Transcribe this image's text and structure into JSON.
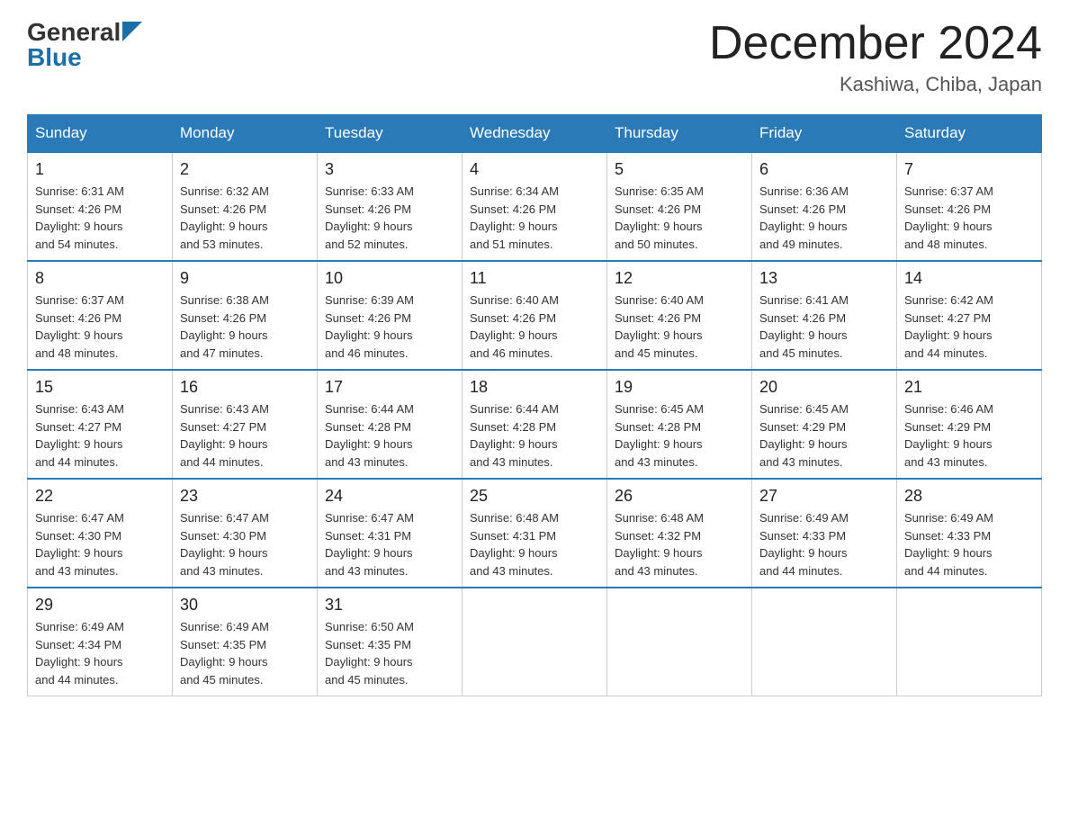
{
  "logo": {
    "general": "General",
    "arrow": "",
    "blue": "Blue"
  },
  "title": "December 2024",
  "subtitle": "Kashiwa, Chiba, Japan",
  "days_of_week": [
    "Sunday",
    "Monday",
    "Tuesday",
    "Wednesday",
    "Thursday",
    "Friday",
    "Saturday"
  ],
  "weeks": [
    [
      {
        "day": "1",
        "sunrise": "6:31 AM",
        "sunset": "4:26 PM",
        "daylight": "9 hours and 54 minutes."
      },
      {
        "day": "2",
        "sunrise": "6:32 AM",
        "sunset": "4:26 PM",
        "daylight": "9 hours and 53 minutes."
      },
      {
        "day": "3",
        "sunrise": "6:33 AM",
        "sunset": "4:26 PM",
        "daylight": "9 hours and 52 minutes."
      },
      {
        "day": "4",
        "sunrise": "6:34 AM",
        "sunset": "4:26 PM",
        "daylight": "9 hours and 51 minutes."
      },
      {
        "day": "5",
        "sunrise": "6:35 AM",
        "sunset": "4:26 PM",
        "daylight": "9 hours and 50 minutes."
      },
      {
        "day": "6",
        "sunrise": "6:36 AM",
        "sunset": "4:26 PM",
        "daylight": "9 hours and 49 minutes."
      },
      {
        "day": "7",
        "sunrise": "6:37 AM",
        "sunset": "4:26 PM",
        "daylight": "9 hours and 48 minutes."
      }
    ],
    [
      {
        "day": "8",
        "sunrise": "6:37 AM",
        "sunset": "4:26 PM",
        "daylight": "9 hours and 48 minutes."
      },
      {
        "day": "9",
        "sunrise": "6:38 AM",
        "sunset": "4:26 PM",
        "daylight": "9 hours and 47 minutes."
      },
      {
        "day": "10",
        "sunrise": "6:39 AM",
        "sunset": "4:26 PM",
        "daylight": "9 hours and 46 minutes."
      },
      {
        "day": "11",
        "sunrise": "6:40 AM",
        "sunset": "4:26 PM",
        "daylight": "9 hours and 46 minutes."
      },
      {
        "day": "12",
        "sunrise": "6:40 AM",
        "sunset": "4:26 PM",
        "daylight": "9 hours and 45 minutes."
      },
      {
        "day": "13",
        "sunrise": "6:41 AM",
        "sunset": "4:26 PM",
        "daylight": "9 hours and 45 minutes."
      },
      {
        "day": "14",
        "sunrise": "6:42 AM",
        "sunset": "4:27 PM",
        "daylight": "9 hours and 44 minutes."
      }
    ],
    [
      {
        "day": "15",
        "sunrise": "6:43 AM",
        "sunset": "4:27 PM",
        "daylight": "9 hours and 44 minutes."
      },
      {
        "day": "16",
        "sunrise": "6:43 AM",
        "sunset": "4:27 PM",
        "daylight": "9 hours and 44 minutes."
      },
      {
        "day": "17",
        "sunrise": "6:44 AM",
        "sunset": "4:28 PM",
        "daylight": "9 hours and 43 minutes."
      },
      {
        "day": "18",
        "sunrise": "6:44 AM",
        "sunset": "4:28 PM",
        "daylight": "9 hours and 43 minutes."
      },
      {
        "day": "19",
        "sunrise": "6:45 AM",
        "sunset": "4:28 PM",
        "daylight": "9 hours and 43 minutes."
      },
      {
        "day": "20",
        "sunrise": "6:45 AM",
        "sunset": "4:29 PM",
        "daylight": "9 hours and 43 minutes."
      },
      {
        "day": "21",
        "sunrise": "6:46 AM",
        "sunset": "4:29 PM",
        "daylight": "9 hours and 43 minutes."
      }
    ],
    [
      {
        "day": "22",
        "sunrise": "6:47 AM",
        "sunset": "4:30 PM",
        "daylight": "9 hours and 43 minutes."
      },
      {
        "day": "23",
        "sunrise": "6:47 AM",
        "sunset": "4:30 PM",
        "daylight": "9 hours and 43 minutes."
      },
      {
        "day": "24",
        "sunrise": "6:47 AM",
        "sunset": "4:31 PM",
        "daylight": "9 hours and 43 minutes."
      },
      {
        "day": "25",
        "sunrise": "6:48 AM",
        "sunset": "4:31 PM",
        "daylight": "9 hours and 43 minutes."
      },
      {
        "day": "26",
        "sunrise": "6:48 AM",
        "sunset": "4:32 PM",
        "daylight": "9 hours and 43 minutes."
      },
      {
        "day": "27",
        "sunrise": "6:49 AM",
        "sunset": "4:33 PM",
        "daylight": "9 hours and 44 minutes."
      },
      {
        "day": "28",
        "sunrise": "6:49 AM",
        "sunset": "4:33 PM",
        "daylight": "9 hours and 44 minutes."
      }
    ],
    [
      {
        "day": "29",
        "sunrise": "6:49 AM",
        "sunset": "4:34 PM",
        "daylight": "9 hours and 44 minutes."
      },
      {
        "day": "30",
        "sunrise": "6:49 AM",
        "sunset": "4:35 PM",
        "daylight": "9 hours and 45 minutes."
      },
      {
        "day": "31",
        "sunrise": "6:50 AM",
        "sunset": "4:35 PM",
        "daylight": "9 hours and 45 minutes."
      },
      null,
      null,
      null,
      null
    ]
  ]
}
